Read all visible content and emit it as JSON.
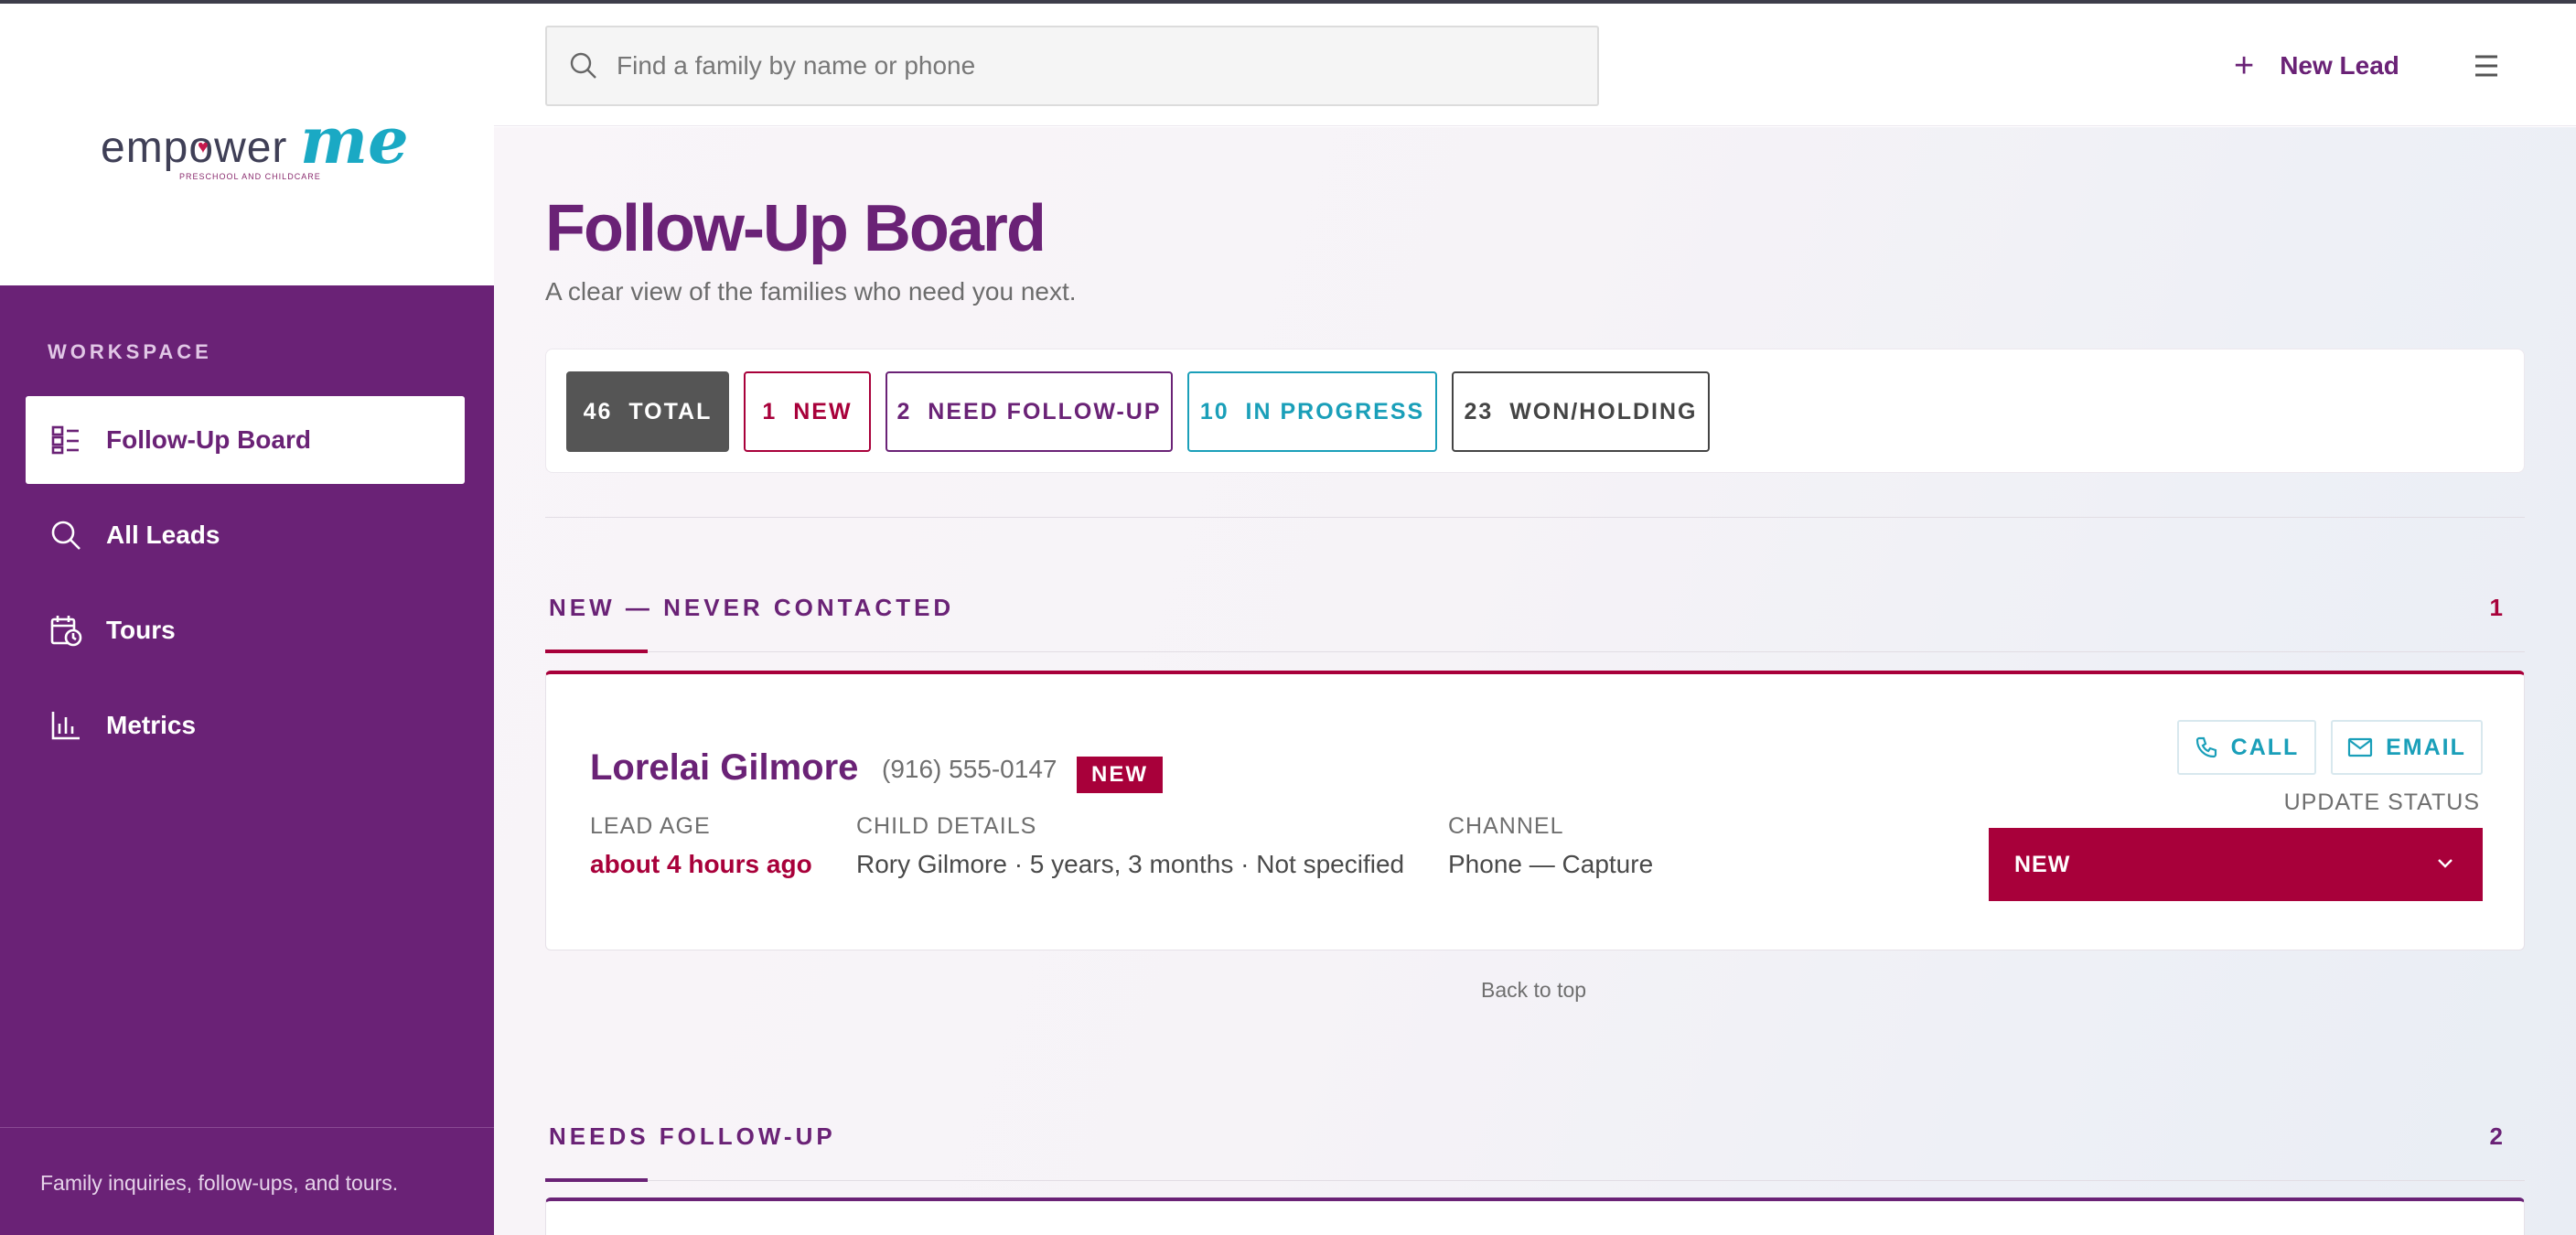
{
  "brand": {
    "logo_word": "empower",
    "logo_accent": "me",
    "logo_sub": "PRESCHOOL AND CHILDCARE"
  },
  "sidebar": {
    "section_label": "WORKSPACE",
    "items": [
      {
        "label": "Follow-Up Board",
        "icon": "board-icon",
        "active": true
      },
      {
        "label": "All Leads",
        "icon": "search-icon",
        "active": false
      },
      {
        "label": "Tours",
        "icon": "calendar-clock-icon",
        "active": false
      },
      {
        "label": "Metrics",
        "icon": "bar-chart-icon",
        "active": false
      }
    ],
    "footer": "Family inquiries, follow-ups, and tours."
  },
  "topbar": {
    "search_placeholder": "Find a family by name or phone",
    "search_value": "",
    "new_lead_label": "New Lead"
  },
  "page": {
    "title": "Follow-Up Board",
    "subtitle": "A clear view of the families who need you next."
  },
  "filters": [
    {
      "count": "46",
      "label": "TOTAL",
      "color": "#555555",
      "filled": true
    },
    {
      "count": "1",
      "label": "NEW",
      "color": "#a8003a",
      "filled": false
    },
    {
      "count": "2",
      "label": "NEED FOLLOW-UP",
      "color": "#6a2276",
      "filled": false
    },
    {
      "count": "10",
      "label": "IN PROGRESS",
      "color": "#1a9fb9",
      "filled": false
    },
    {
      "count": "23",
      "label": "WON/HOLDING",
      "color": "#444444",
      "filled": false
    }
  ],
  "sections": {
    "new": {
      "title": "NEW — NEVER CONTACTED",
      "count": "1",
      "color": "#a8003a"
    },
    "followup": {
      "title": "NEEDS FOLLOW-UP",
      "count": "2",
      "color": "#6a2276"
    }
  },
  "lead": {
    "name": "Lorelai Gilmore",
    "phone": "(916) 555-0147",
    "badge": "NEW",
    "age_label": "LEAD AGE",
    "age_value": "about 4 hours ago",
    "child_label": "CHILD DETAILS",
    "child_value": "Rory Gilmore · 5 years, 3 months · Not specified",
    "channel_label": "CHANNEL",
    "channel_value": "Phone — Capture",
    "call_label": "CALL",
    "email_label": "EMAIL",
    "update_label": "UPDATE STATUS",
    "status_value": "NEW"
  },
  "back_to_top": "Back to top"
}
